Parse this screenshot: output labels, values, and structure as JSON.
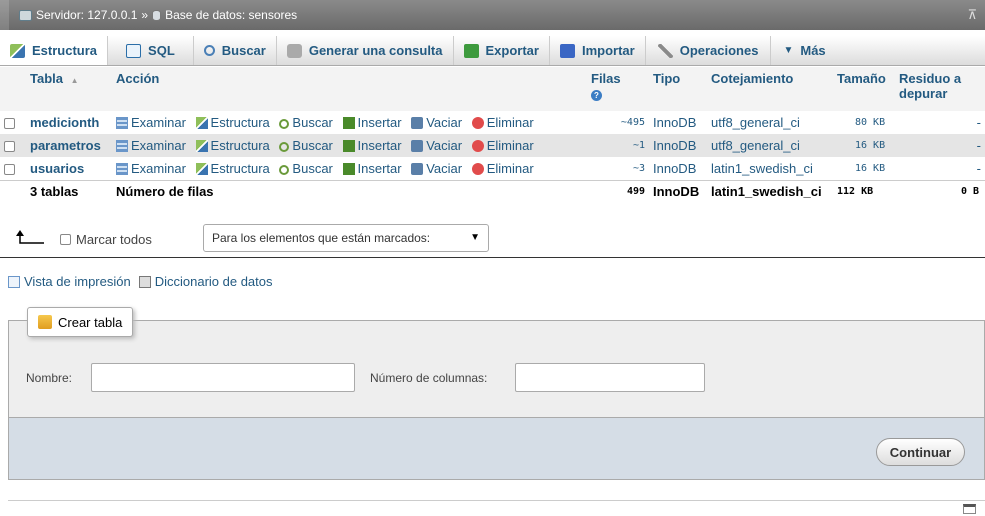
{
  "breadcrumb": {
    "server_label": "Servidor: 127.0.0.1",
    "separator": "»",
    "db_label": "Base de datos: sensores",
    "collapse_glyph": "⊼"
  },
  "tabs": [
    {
      "label": "Estructura",
      "icon": "structure-icon"
    },
    {
      "label": "SQL",
      "icon": "sql-icon"
    },
    {
      "label": "Buscar",
      "icon": "search-icon"
    },
    {
      "label": "Generar una consulta",
      "icon": "query-icon"
    },
    {
      "label": "Exportar",
      "icon": "export-icon"
    },
    {
      "label": "Importar",
      "icon": "import-icon"
    },
    {
      "label": "Operaciones",
      "icon": "wrench-icon"
    },
    {
      "label": "Más",
      "icon": "chevron-down-icon"
    }
  ],
  "columns": {
    "tabla": "Tabla",
    "sort": "▲",
    "accion": "Acción",
    "filas": "Filas",
    "tipo": "Tipo",
    "cotejamiento": "Cotejamiento",
    "tamano": "Tamaño",
    "residuo": "Residuo a depurar"
  },
  "actions": {
    "examinar": "Examinar",
    "estructura": "Estructura",
    "buscar": "Buscar",
    "insertar": "Insertar",
    "vaciar": "Vaciar",
    "eliminar": "Eliminar"
  },
  "rows": [
    {
      "name": "medicionth",
      "rows": "~495",
      "type": "InnoDB",
      "collation": "utf8_general_ci",
      "size": "80 KB",
      "overhead": "-"
    },
    {
      "name": "parametros",
      "rows": "~1",
      "type": "InnoDB",
      "collation": "utf8_general_ci",
      "size": "16 KB",
      "overhead": "-"
    },
    {
      "name": "usuarios",
      "rows": "~3",
      "type": "InnoDB",
      "collation": "latin1_swedish_ci",
      "size": "16 KB",
      "overhead": "-"
    }
  ],
  "footer": {
    "tables": "3 tablas",
    "label": "Número de filas",
    "rows": "499",
    "type": "InnoDB",
    "collation": "latin1_swedish_ci",
    "size": "112 KB",
    "overhead": "0 B"
  },
  "bulk": {
    "mark_all": "Marcar todos",
    "with_selected": "Para los elementos que están marcados:",
    "caret": "▼"
  },
  "links": {
    "print_view": "Vista de impresión",
    "data_dictionary": "Diccionario de datos"
  },
  "create_table": {
    "legend": "Crear tabla",
    "name_label": "Nombre:",
    "name_value": "",
    "columns_label": "Número de columnas:",
    "columns_value": "",
    "submit": "Continuar"
  }
}
